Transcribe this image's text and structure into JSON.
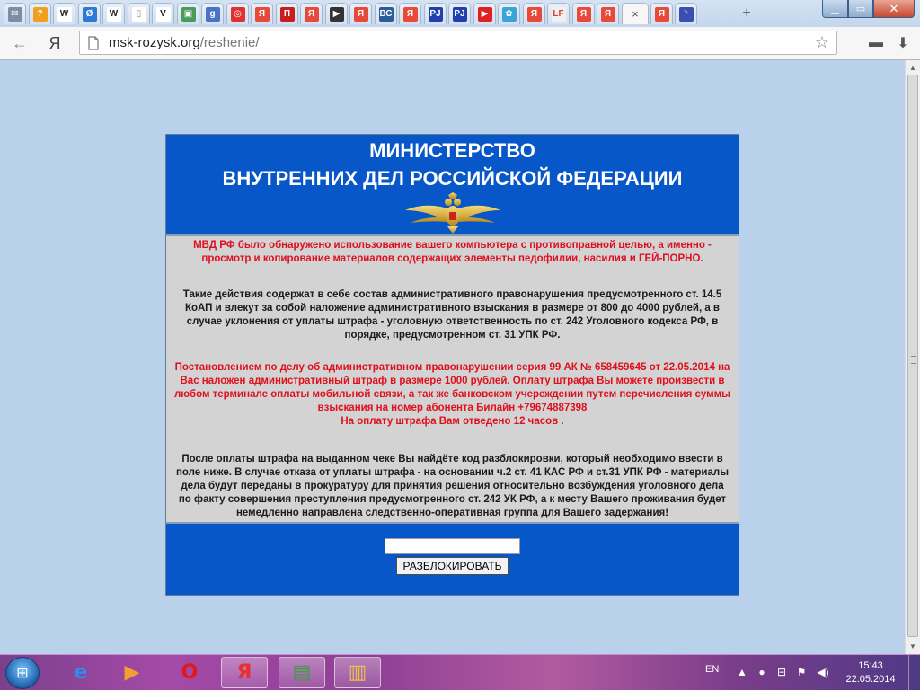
{
  "browser": {
    "tabs": [
      {
        "name": "mail",
        "glyph": "✉",
        "bg": "#7a8ea8"
      },
      {
        "name": "answers",
        "glyph": "?",
        "bg": "#f0a01e"
      },
      {
        "name": "wikipedia",
        "glyph": "W",
        "bg": "#ffffff",
        "fg": "#222"
      },
      {
        "name": "livejournal",
        "glyph": "Ø",
        "bg": "#2b7bd6"
      },
      {
        "name": "wikipedia-2",
        "glyph": "W",
        "bg": "#ffffff",
        "fg": "#222"
      },
      {
        "name": "blank-page",
        "glyph": "▯",
        "bg": "#ffffff",
        "fg": "#888"
      },
      {
        "name": "vk",
        "glyph": "V",
        "bg": "#ffffff",
        "fg": "#222"
      },
      {
        "name": "photos",
        "glyph": "▣",
        "bg": "#4a9a5a"
      },
      {
        "name": "google",
        "glyph": "g",
        "bg": "#4a72c8"
      },
      {
        "name": "target",
        "glyph": "◎",
        "bg": "#e03030"
      },
      {
        "name": "yandex",
        "glyph": "Я",
        "bg": "#e84a3a"
      },
      {
        "name": "news",
        "glyph": "П",
        "bg": "#c81e1e"
      },
      {
        "name": "yandex-2",
        "glyph": "Я",
        "bg": "#e84a3a"
      },
      {
        "name": "play",
        "glyph": "▶",
        "bg": "#333333"
      },
      {
        "name": "yandex-3",
        "glyph": "Я",
        "bg": "#e84a3a"
      },
      {
        "name": "bc",
        "glyph": "ВС",
        "bg": "#2e5c9a"
      },
      {
        "name": "yandex-4",
        "glyph": "Я",
        "bg": "#e84a3a"
      },
      {
        "name": "pj",
        "glyph": "РJ",
        "bg": "#2040b0"
      },
      {
        "name": "pj-2",
        "glyph": "РJ",
        "bg": "#2040b0"
      },
      {
        "name": "youtube",
        "glyph": "▶",
        "bg": "#e02020"
      },
      {
        "name": "flower",
        "glyph": "✿",
        "bg": "#3aa5d8"
      },
      {
        "name": "yandex-5",
        "glyph": "Я",
        "bg": "#e84a3a"
      },
      {
        "name": "lf",
        "glyph": "LF",
        "bg": "#f0f0f0",
        "fg": "#e0402a"
      },
      {
        "name": "yandex-6",
        "glyph": "Я",
        "bg": "#e84a3a"
      },
      {
        "name": "yandex-7",
        "glyph": "Я",
        "bg": "#e84a3a"
      }
    ],
    "active_tab_close": "×",
    "tabs_after": [
      {
        "name": "yandex-8",
        "glyph": "Я",
        "bg": "#e84a3a"
      },
      {
        "name": "loading",
        "glyph": "◝",
        "bg": "#3a4fb0"
      }
    ],
    "new_tab": "+",
    "window": {
      "minimize": "▁",
      "maximize": "▭",
      "close": "✕"
    },
    "back": "←",
    "yandex_button": "Я",
    "url_host": "msk-rozysk.org",
    "url_path": "/reshenie/",
    "star": "☆",
    "downloads": "▬",
    "download_arrow": "⬇"
  },
  "page": {
    "title_line1": "МИНИСТЕРСТВО",
    "title_line2": "ВНУТРЕННИХ ДЕЛ РОССИЙСКОЙ ФЕДЕРАЦИИ",
    "para1": "МВД РФ было обнаружено использование вашего компьютера с противоправной целью, а именно - просмотр и копирование материалов содержащих элементы педофилии, насилия и ГЕЙ-ПОРНО.",
    "para2": "Такие действия содержат в себе состав административного правонарушения предусмотренного ст. 14.5 КоАП и влекут за собой наложение административного взыскания в размере от 800 до 4000 рублей, а в случае уклонения от уплаты штрафа - уголовную ответственность по ст. 242 Уголовного кодекса РФ, в порядке, предусмотренном ст. 31 УПК РФ.",
    "para3a": "Постановлением по делу об административном правонарушении серия 99 АК № 658459645 от 22.05.2014 на Вас наложен административный штраф в размере 1000 рублей. Оплату штрафа Вы можете произвести в любом терминале оплаты мобильной связи, а так же банковском учереждении путем перечисления суммы взыскания на номер абонента Билайн +79674887398",
    "para3b": "На оплату штрафа Вам отведено 12 часов .",
    "para4": "После оплаты штрафа на выданном чеке Вы найдёте код разблокировки, который необходимо ввести в поле ниже. В случае отказа от уплаты штрафа - на основании ч.2 ст. 41 КАС РФ и ст.31 УПК РФ - материалы дела будут переданы в прокуратуру для принятия решения относительно возбуждения уголовного дела по факту совершения преступления предусмотренного ст. 242 УК РФ, а к месту Вашего проживания будет немедленно направлена следственно-оперативная группа для Вашего задержания!",
    "code_value": "",
    "unlock_label": "РАЗБЛОКИРОВАТЬ"
  },
  "scrollbar": {
    "up": "▲",
    "down": "▼"
  },
  "taskbar": {
    "start": "⊞",
    "items": [
      {
        "name": "ie",
        "glyph": "e",
        "color": "#2f8ee8",
        "state": "pinned"
      },
      {
        "name": "media-player",
        "glyph": "▶",
        "color": "#f0a030",
        "state": "pinned"
      },
      {
        "name": "opera",
        "glyph": "O",
        "color": "#e01818",
        "state": "pinned"
      },
      {
        "name": "yandex-browser",
        "glyph": "Я",
        "color": "#e83030",
        "state": "open"
      },
      {
        "name": "monitor-app",
        "glyph": "▤",
        "color": "#3aa040",
        "state": "open"
      },
      {
        "name": "explorer",
        "glyph": "▥",
        "color": "#e8c050",
        "state": "open"
      }
    ],
    "lang": "EN",
    "tray": [
      "▲",
      "●",
      "⊟",
      "⚑",
      "◀)"
    ],
    "time": "15:43",
    "date": "22.05.2014"
  }
}
